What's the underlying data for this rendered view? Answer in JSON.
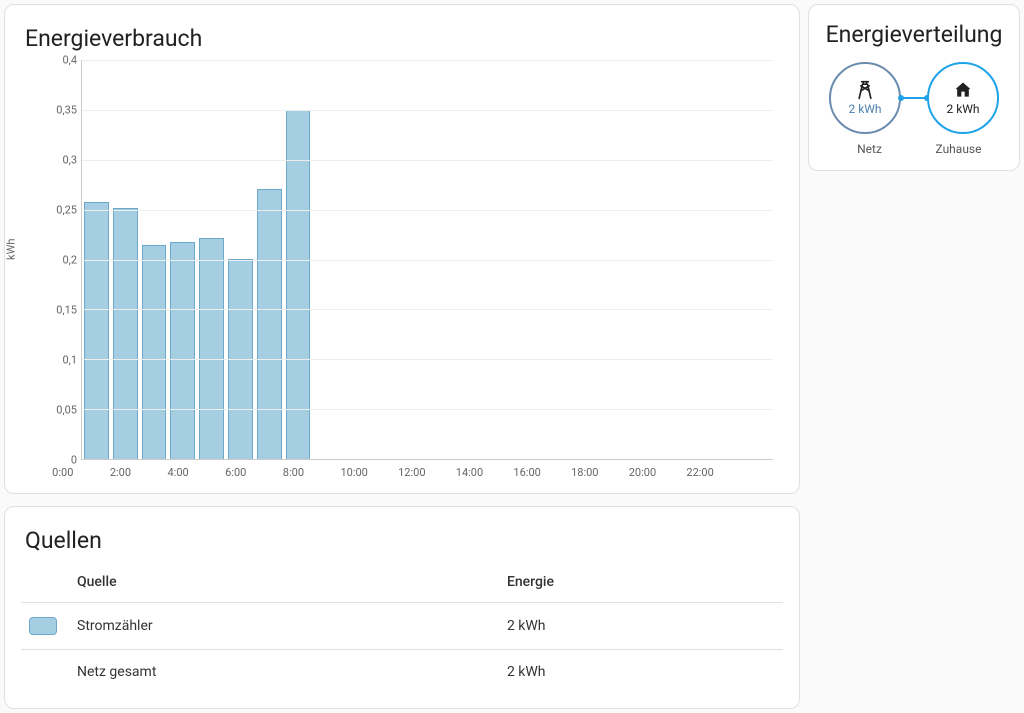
{
  "chart_card": {
    "title": "Energieverbrauch"
  },
  "chart_data": {
    "type": "bar",
    "title": "Energieverbrauch",
    "xlabel": "",
    "ylabel": "kWh",
    "ylim": [
      0,
      0.4
    ],
    "y_ticks": [
      "0",
      "0,05",
      "0,1",
      "0,15",
      "0,2",
      "0,25",
      "0,3",
      "0,35",
      "0,4"
    ],
    "x_ticks": [
      "0:00",
      "2:00",
      "4:00",
      "6:00",
      "8:00",
      "10:00",
      "12:00",
      "14:00",
      "16:00",
      "18:00",
      "20:00",
      "22:00"
    ],
    "categories": [
      "0:00",
      "1:00",
      "2:00",
      "3:00",
      "4:00",
      "5:00",
      "6:00",
      "7:00",
      "8:00",
      "9:00",
      "10:00",
      "11:00",
      "12:00",
      "13:00",
      "14:00",
      "15:00",
      "16:00",
      "17:00",
      "18:00",
      "19:00",
      "20:00",
      "21:00",
      "22:00",
      "23:00"
    ],
    "series": [
      {
        "name": "Stromzähler",
        "color": "#a6cee3",
        "values": [
          0.258,
          0.252,
          0.215,
          0.218,
          0.222,
          0.201,
          0.271,
          0.35,
          null,
          null,
          null,
          null,
          null,
          null,
          null,
          null,
          null,
          null,
          null,
          null,
          null,
          null,
          null,
          null
        ]
      }
    ]
  },
  "sources": {
    "title": "Quellen",
    "headers": {
      "source": "Quelle",
      "energy": "Energie"
    },
    "rows": [
      {
        "swatch": true,
        "label": "Stromzähler",
        "energy": "2 kWh"
      },
      {
        "swatch": false,
        "label": "Netz gesamt",
        "energy": "2 kWh"
      }
    ]
  },
  "distribution": {
    "title": "Energieverteilung",
    "grid": {
      "label": "Netz",
      "value": "2 kWh"
    },
    "home": {
      "label": "Zuhause",
      "value": "2 kWh"
    }
  }
}
